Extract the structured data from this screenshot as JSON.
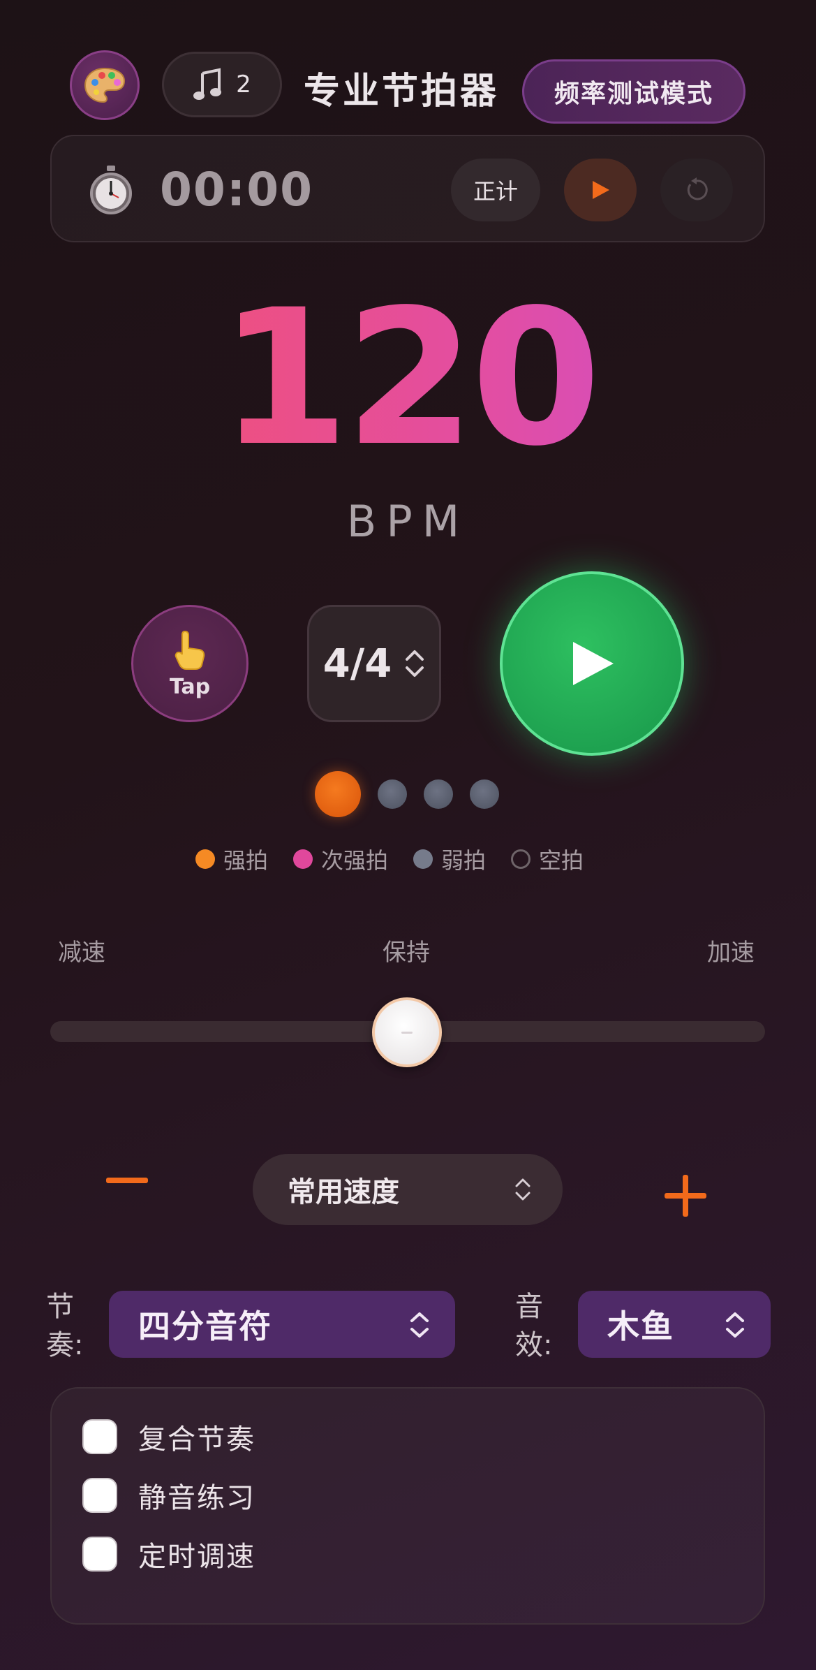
{
  "header": {
    "title": "专业节拍器",
    "counter_value": "2",
    "freq_test_label": "频率测试模式"
  },
  "timer": {
    "time": "00:00",
    "mode_label": "正计"
  },
  "bpm": {
    "value": "120",
    "unit": "BPM"
  },
  "controls": {
    "tap_label": "Tap",
    "time_signature": "4/4"
  },
  "beats": {
    "count": 4,
    "active_index": 0
  },
  "legend": [
    {
      "label": "强拍",
      "color": "#f58a24"
    },
    {
      "label": "次强拍",
      "color": "#e0489c"
    },
    {
      "label": "弱拍",
      "color": "#767b8b"
    },
    {
      "label": "空拍",
      "color": "transparent"
    }
  ],
  "slider": {
    "left_label": "减速",
    "center_label": "保持",
    "right_label": "加速",
    "value": 0.5
  },
  "speed": {
    "preset_label": "常用速度"
  },
  "rhythm": {
    "label": "节奏:",
    "value": "四分音符"
  },
  "sound": {
    "label": "音效:",
    "value": "木鱼"
  },
  "options": [
    {
      "label": "复合节奏",
      "checked": false
    },
    {
      "label": "静音练习",
      "checked": false
    },
    {
      "label": "定时调速",
      "checked": false
    }
  ],
  "colors": {
    "accent_orange": "#f26a1b",
    "play_green": "#22a955",
    "purple_select": "#4f2a68"
  }
}
